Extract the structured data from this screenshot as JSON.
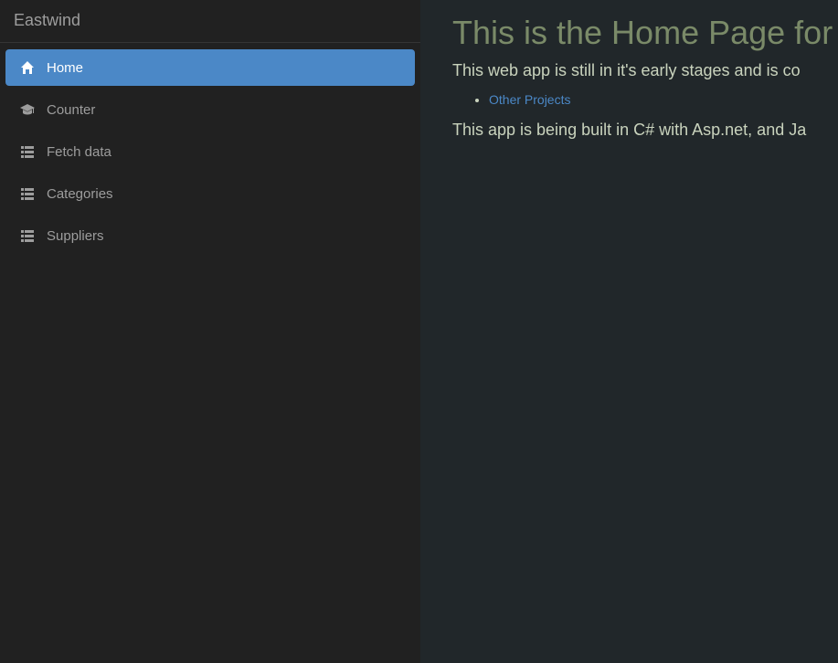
{
  "sidebar": {
    "brand": "Eastwind",
    "items": [
      {
        "label": "Home",
        "icon": "home-icon",
        "active": true
      },
      {
        "label": "Counter",
        "icon": "graduation-cap-icon",
        "active": false
      },
      {
        "label": "Fetch data",
        "icon": "list-icon",
        "active": false
      },
      {
        "label": "Categories",
        "icon": "list-icon",
        "active": false
      },
      {
        "label": "Suppliers",
        "icon": "list-icon",
        "active": false
      }
    ]
  },
  "main": {
    "title": "This is the Home Page for",
    "intro": "This web app is still in it's early stages and is co",
    "links": [
      {
        "label": "Other Projects"
      }
    ],
    "built_with": "This app is being built in C# with Asp.net, and Ja"
  },
  "colors": {
    "sidebar_bg": "#212121",
    "main_bg": "#21272a",
    "accent": "#4b88c7",
    "title": "#7a8a68",
    "body_text": "#c9d3bd",
    "nav_text": "#9d9d9d"
  }
}
